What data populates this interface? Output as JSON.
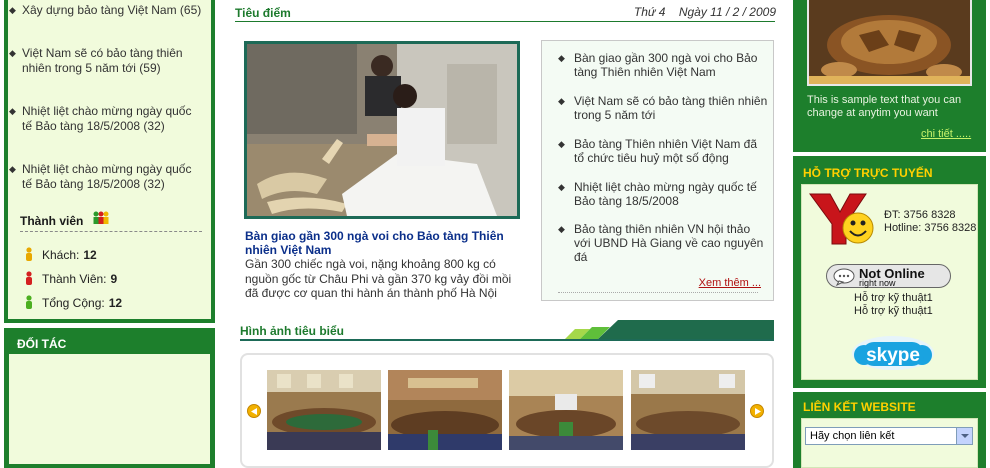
{
  "left": {
    "news_items": [
      {
        "title": "Xây dựng bảo tàng Việt Nam (65)"
      },
      {
        "title": "Việt Nam sẽ có bảo tàng thiên nhiên trong 5 năm tới (59)"
      },
      {
        "title": "Nhiệt liệt chào mừng ngày quốc tế Bảo tàng 18/5/2008 (32)"
      },
      {
        "title": "Nhiệt liệt chào mừng ngày quốc tế Bảo tàng 18/5/2008 (32)"
      }
    ],
    "members": {
      "heading": "Thành viên",
      "rows": [
        {
          "label": "Khách:",
          "value": "12"
        },
        {
          "label": "Thành Viên:",
          "value": "9"
        },
        {
          "label": "Tổng Cộng:",
          "value": "12"
        }
      ]
    },
    "partners_title": "ĐỐI TÁC"
  },
  "center": {
    "featured_title": "Tiêu điểm",
    "date": "Thứ 4    Ngày 11 / 2 / 2009",
    "headline": "Bàn giao gần 300 ngà voi cho Bảo tàng Thiên nhiên Việt Nam",
    "summary": "Gần 300 chiếc ngà voi, nặng khoảng 800 kg có nguồn gốc từ Châu Phi và gần 370 kg vảy đồi mồi đã được cơ quan thi hành án thành phố Hà Nội",
    "side_news": [
      "Bàn giao gần 300 ngà voi cho Bảo tàng Thiên nhiên Việt Nam",
      "Việt Nam sẽ có bảo tàng thiên nhiên trong 5 năm tới",
      "Bảo tàng Thiên nhiên Việt Nam đã tổ chức tiêu huỷ một số động",
      "Nhiệt liệt chào mừng ngày quốc tế Bảo tàng 18/5/2008",
      "Bảo tàng thiên nhiên VN hội thảo với UBND Hà Giang về cao nguyên đá"
    ],
    "see_more": "Xem thêm ...",
    "gallery_title": "Hình ảnh tiêu biểu"
  },
  "right": {
    "sample_text": "This is sample text that you can change at anytim you want",
    "detail_link": "chi tiết .....",
    "support": {
      "title": "HỖ TRỢ TRỰC TUYẾN",
      "phone": "ĐT: 3756 8328",
      "hotline": "Hotline: 3756 8328",
      "status_main": "Not Online",
      "status_sub": "right now",
      "tech1": "Hỗ trợ kỹ thuật1",
      "tech2": "Hỗ trợ kỹ thuật1",
      "skype_label": "skype"
    },
    "links": {
      "title": "LIÊN KẾT WEBSITE",
      "select_value": "Hãy chọn liên kết"
    }
  },
  "colors": {
    "brand_green": "#1d7f2c",
    "panel_bg": "#f1fbdc",
    "headline_blue": "#0b2f8a",
    "accent_yellow": "#ffd000"
  }
}
